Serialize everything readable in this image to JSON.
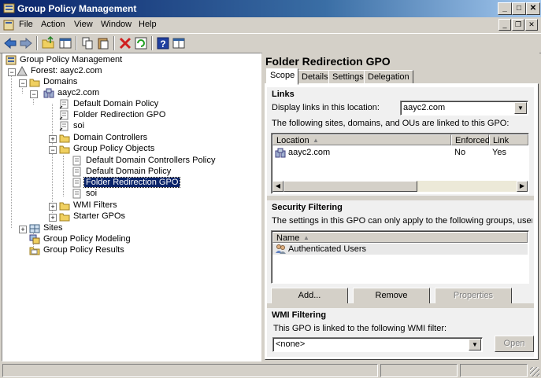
{
  "window": {
    "title": "Group Policy Management"
  },
  "menubar": {
    "items": [
      "File",
      "Action",
      "View",
      "Window",
      "Help"
    ]
  },
  "tree": {
    "root": "Group Policy Management",
    "forest": "Forest: aayc2.com",
    "domains": "Domains",
    "domain": "aayc2.com",
    "default_domain_policy": "Default Domain Policy",
    "folder_redirection_gpo": "Folder Redirection GPO",
    "soi": "soi",
    "domain_controllers": "Domain Controllers",
    "group_policy_objects": "Group Policy Objects",
    "gpo_default_dc_policy": "Default Domain Controllers Policy",
    "gpo_default_domain_policy": "Default Domain Policy",
    "gpo_folder_redirection": "Folder Redirection GPO",
    "gpo_soi": "soi",
    "wmi_filters": "WMI Filters",
    "starter_gpos": "Starter GPOs",
    "sites": "Sites",
    "modeling": "Group Policy Modeling",
    "results": "Group Policy Results"
  },
  "details": {
    "title": "Folder Redirection GPO",
    "tabs": [
      "Scope",
      "Details",
      "Settings",
      "Delegation"
    ],
    "links": {
      "heading": "Links",
      "display_label": "Display links in this location:",
      "location_value": "aayc2.com",
      "linked_text": "The following sites, domains, and OUs are linked to this GPO:",
      "columns": [
        "Location",
        "Enforced",
        "Link Enab"
      ],
      "rows": [
        {
          "location": "aayc2.com",
          "enforced": "No",
          "link_enabled": "Yes"
        }
      ]
    },
    "security": {
      "heading": "Security Filtering",
      "desc": "The settings in this GPO can only apply to the following groups, users, and co",
      "column": "Name",
      "rows": [
        "Authenticated Users"
      ],
      "add_button": "Add...",
      "remove_button": "Remove",
      "properties_button": "Properties"
    },
    "wmi": {
      "heading": "WMI Filtering",
      "desc": "This GPO is linked to the following WMI filter:",
      "value": "<none>",
      "open_button": "Open"
    }
  }
}
